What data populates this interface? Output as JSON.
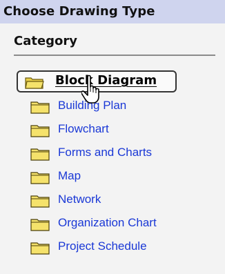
{
  "dialog": {
    "title": "Choose Drawing Type",
    "section_label": "Category"
  },
  "categories": [
    {
      "label": "Block Diagram",
      "selected": true
    },
    {
      "label": "Building Plan",
      "selected": false
    },
    {
      "label": "Flowchart",
      "selected": false
    },
    {
      "label": "Forms and Charts",
      "selected": false
    },
    {
      "label": "Map",
      "selected": false
    },
    {
      "label": "Network",
      "selected": false
    },
    {
      "label": "Organization Chart",
      "selected": false
    },
    {
      "label": "Project Schedule",
      "selected": false
    }
  ],
  "icons": {
    "folder": "folder-icon",
    "cursor": "hand-pointer-icon"
  },
  "colors": {
    "title_bar": "#cfd4ee",
    "link_text": "#1a38d6",
    "folder_fill": "#f5e26b"
  }
}
